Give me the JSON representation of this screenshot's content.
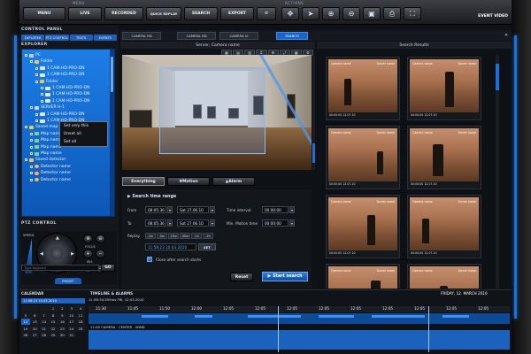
{
  "menu": {
    "label": "MENU",
    "items": [
      "MENU",
      "LIVE",
      "RECORDED",
      "QUICK REPLAY",
      "SEARCH",
      "EXPORT",
      "SETTINGS"
    ],
    "actions_label": "ACTIONS",
    "event_video": "EVENT VIDEO"
  },
  "left_panel": {
    "control_panel_title": "CONTROL PANEL",
    "control_tabs": [
      "EXPLORER",
      "PTZ CONTROL",
      "TEXTS",
      "EVENTS"
    ],
    "explorer_title": "EXPLORER",
    "tree": [
      {
        "label": "PC",
        "icon": "pc-icon"
      },
      {
        "label": "Folder",
        "icon": "folder-icon"
      },
      {
        "label": "1 CAM-HD-PRO-DN",
        "icon": "camera-icon"
      },
      {
        "label": "1 CAM-HD-PRO-DN",
        "icon": "camera-icon"
      },
      {
        "label": "Folder",
        "icon": "folder-icon"
      },
      {
        "label": "1 CAM-HD-PRO-DN",
        "icon": "camera-icon"
      },
      {
        "label": "1 CAM-HD-PRO-DN",
        "icon": "camera-icon"
      },
      {
        "label": "1 CAM-HD-PRO-DN",
        "icon": "camera-icon"
      },
      {
        "label": "SERVER H-1",
        "icon": "server-icon"
      },
      {
        "label": "1 CAM-HD-PRO-DN",
        "icon": "camera-icon"
      },
      {
        "label": "1 CAM-HD-PRO-DN",
        "icon": "camera-icon"
      },
      {
        "label": "Saved map",
        "icon": "folder-icon"
      },
      {
        "label": "Map name",
        "icon": "map-icon"
      },
      {
        "label": "Map name",
        "icon": "map-icon"
      },
      {
        "label": "Map name",
        "icon": "map-icon"
      },
      {
        "label": "Map name",
        "icon": "map-icon"
      },
      {
        "label": "Saved detector",
        "icon": "folder-icon"
      },
      {
        "label": "Detector name",
        "icon": "detector-icon"
      },
      {
        "label": "Detector name",
        "icon": "detector-icon"
      },
      {
        "label": "Detector name",
        "icon": "detector-icon"
      }
    ],
    "context_menu": [
      "Set only this",
      "Unset all",
      "Set all"
    ],
    "ptz_title": "PTZ CONTROL",
    "speed_label": "SPEED",
    "focus_label": "FOCUS",
    "iris_label": "IRIS",
    "preset_label": "PRESET",
    "keyword_placeholder": "Type keyword",
    "go_label": "GO"
  },
  "camera_tabs": [
    "CAMERA HD",
    "CAMERA HD",
    "CAMERA VI",
    "SEARCH"
  ],
  "server_title": "Server, Camera name",
  "results_title": "Search Results",
  "search_modes": [
    "Everything",
    "Motion",
    "Alarm"
  ],
  "search_form": {
    "title": "Search time range",
    "from_label": "From",
    "from_time": "08:05:36",
    "from_date": "Sat 27.06.10",
    "to_label": "To",
    "to_time": "08:05:36",
    "to_date": "Sat 27.06.10",
    "replay_label": "Replay",
    "replay_buttons": [
      "-1m",
      "-5m",
      "-10m",
      "-30m",
      "-1h",
      "-2h"
    ],
    "timestamp": "11:58:23 10.03.2010",
    "set_label": "SET",
    "time_interval_label": "Time interval",
    "time_interval_value": "00:00:00",
    "min_motion_label": "Min. Motion time",
    "min_motion_value": "00:00:00",
    "close_after_label": "Close after search starts",
    "reset_label": "Reset",
    "start_label": "Start search"
  },
  "thumbnails": [
    {
      "left_caption": "Camera name",
      "right_caption": "Server name",
      "time": "00:00:00  12.07.10"
    },
    {
      "left_caption": "Camera name",
      "right_caption": "Server name",
      "time": "00:00:00  12.07.10"
    },
    {
      "left_caption": "Camera name",
      "right_caption": "Server name",
      "time": "00:00:00  12.07.10"
    },
    {
      "left_caption": "Camera name",
      "right_caption": "Server name",
      "time": "00:00:00  12.07.10"
    },
    {
      "left_caption": "Camera name",
      "right_caption": "Server name",
      "time": "00:00:00  12.07.10"
    },
    {
      "left_caption": "Camera name",
      "right_caption": "Server name",
      "time": "00:00:00  12.07.10"
    },
    {
      "left_caption": "Camera name",
      "right_caption": "Server name",
      "time": "00:00:00  12.07.10"
    },
    {
      "left_caption": "Camera name",
      "right_caption": "Server name",
      "time": "00:00:00  12.07.10"
    }
  ],
  "calendar": {
    "title": "CALENDAR",
    "bar_text": "11:58:23  10.03.2010",
    "days": [
      "",
      "",
      "",
      "1",
      "2",
      "3",
      "4",
      "5",
      "6",
      "7",
      "8",
      "9",
      "10",
      "11",
      "12",
      "13",
      "14",
      "15",
      "16",
      "17",
      "18",
      "19",
      "20",
      "21",
      "22",
      "23",
      "24",
      "25",
      "26",
      "27",
      "28",
      "29",
      "30",
      "31"
    ],
    "today": "12"
  },
  "timeline": {
    "title": "TIMELINE & ALARMS",
    "date": "FRIDAY, 12. MARCH 2010",
    "info_line": "11:58:34:555ms   FRI, 12.03.2010",
    "ticks": [
      "11:30",
      "11:45",
      "11:50",
      "12:00",
      "12:05",
      "12:05",
      "12:05",
      "12:05",
      "12:05",
      "12:05",
      "12:05",
      "12:05",
      "12:05"
    ],
    "camera_label": "11:00  CAMERA - CENTER - WIND"
  }
}
